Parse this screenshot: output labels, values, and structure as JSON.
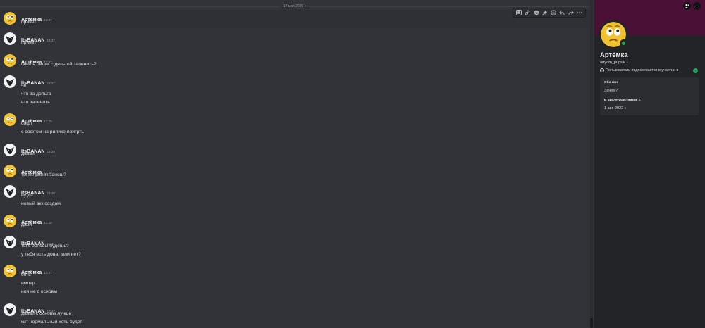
{
  "chat": {
    "date_divider": "17 мая 2025 г.",
    "authors": {
      "artemka": "Артёмка",
      "itsbanan": "ItsBANAN"
    },
    "messages": [
      {
        "author": "Артёмка",
        "time": "13:37",
        "lines": [
          "привет"
        ]
      },
      {
        "author": "ItsBANAN",
        "time": "13:37",
        "lines": [
          "привет"
        ]
      },
      {
        "author": "Артёмка",
        "time": "13:37",
        "lines": [
          "очешь рилик с дельтой запенить?"
        ]
      },
      {
        "author": "ItsBANAN",
        "time": "13:37",
        "lines": [
          "чё",
          "что за дельта",
          "что запенить"
        ]
      },
      {
        "author": "Артёмка",
        "time": "13:38",
        "lines": [
          "софт",
          "с софтом на рилике поигрть"
        ]
      },
      {
        "author": "ItsBANAN",
        "time": "13:38",
        "lines": [
          "давай"
        ]
      },
      {
        "author": "Артёмка",
        "time": "13:38",
        "lines": [
          "ты же рилик занеш?"
        ]
      },
      {
        "author": "ItsBANAN",
        "time": "13:38",
        "lines": [
          "ну да",
          "новый акк создам"
        ]
      },
      {
        "author": "Артёмка",
        "time": "13:38",
        "lines": [
          "давй"
        ]
      },
      {
        "author": "ItsBANAN",
        "time": "13:41",
        "lines": [
          "ты с основы будешь?",
          "у тебя есть донат или нет?"
        ]
      },
      {
        "author": "Артёмка",
        "time": "13:47",
        "lines": [
          "есть",
          "импер",
          "ноя  не с основы"
        ]
      },
      {
        "author": "ItsBANAN",
        "time": "13:47",
        "lines": [
          "давай с основы лучше",
          "кит нормальный хоть будет"
        ]
      }
    ]
  },
  "toolbar": {
    "icons": [
      "app-icon",
      "link-icon",
      "reaction-icon",
      "pin-icon",
      "emoji-icon",
      "reply-icon",
      "forward-icon",
      "more-icon"
    ]
  },
  "profile": {
    "display_name": "Артёмка",
    "username": "artyom_pupsik",
    "username_suffix": "•",
    "warning": "Пользователь подозревается в участии в",
    "about_heading": "Обо мне",
    "about_text": "Зачем?",
    "member_since_heading": "В числе участников с",
    "member_since": "1 авг. 2022 г.",
    "status": "online",
    "banner_color": "#4a1036",
    "status_color": "#23a55a"
  }
}
